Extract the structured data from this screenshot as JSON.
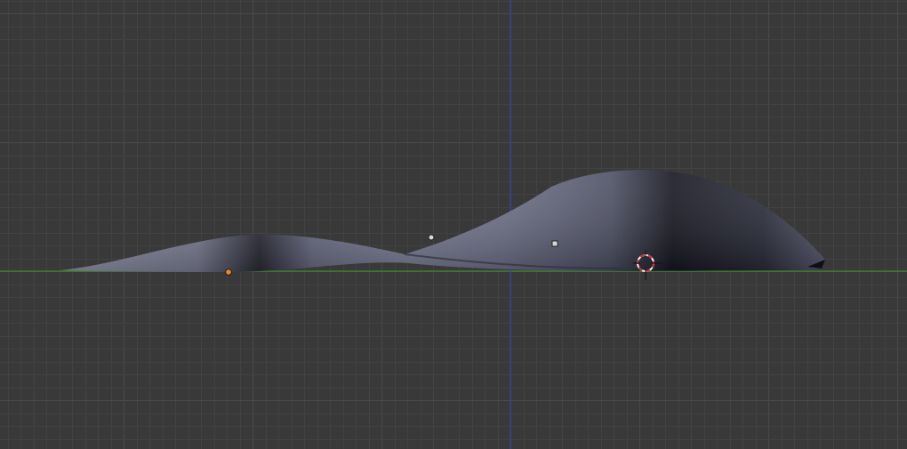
{
  "viewport": {
    "view": "3d-viewport-front-orthographic",
    "colors": {
      "background": "#393939",
      "grid_minor": "#424242",
      "grid_major": "#4a4a4a",
      "x_axis": "#3a8a2a",
      "z_axis": "#3a3ab0",
      "mesh_light": "#8c8fa8",
      "mesh_mid": "#5a5d72",
      "mesh_dark": "#14151c",
      "origin_selected": "#e08a30",
      "control_point": "#d8d8d8",
      "cursor_red": "#c83030",
      "cursor_white": "#f0f0f0"
    }
  },
  "objects": {
    "surface": "curved-surface-mesh",
    "origin": "object-origin-point",
    "points": [
      "control-point",
      "control-point"
    ],
    "cursor": "3d-cursor"
  }
}
